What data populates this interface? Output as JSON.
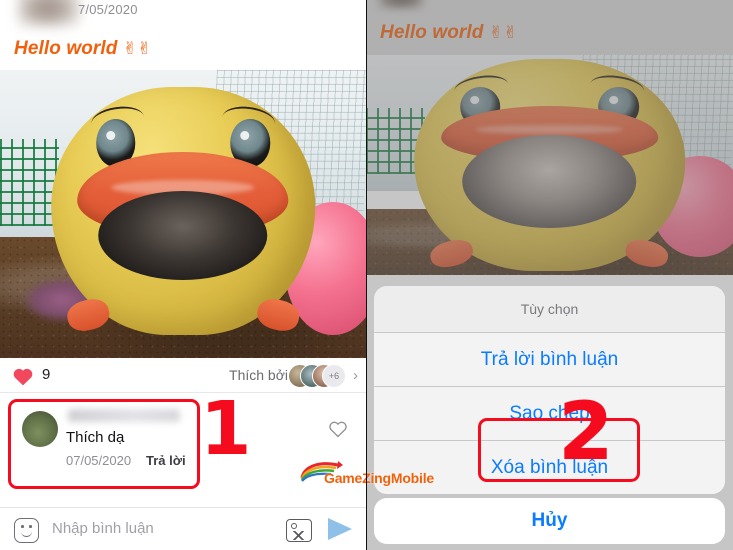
{
  "left": {
    "post_date": "7/05/2020",
    "caption": "Hello world",
    "caption_emoji": "✌✌",
    "likes": {
      "count": "9",
      "liked_by_label": "Thích bởi",
      "extra_count": "+6",
      "chevron": "›"
    },
    "comment": {
      "text": "Thích dạ",
      "date": "07/05/2020",
      "reply_label": "Trả lời"
    },
    "input": {
      "placeholder": "Nhập bình luận",
      "emoji_icon": "smiley-icon",
      "image_icon": "image-icon",
      "send_icon": "send-icon"
    },
    "annotation": "1"
  },
  "right": {
    "caption": "Hello world",
    "caption_emoji": "✌✌",
    "sheet": {
      "title": "Tùy chọn",
      "options": [
        "Trả lời bình luận",
        "Sao chép",
        "Xóa bình luận"
      ],
      "cancel": "Hủy"
    },
    "annotation": "2"
  },
  "watermark": {
    "text": "GameZingMobile"
  },
  "colors": {
    "accent_orange": "#f2600c",
    "annotation_red": "#f40c1e",
    "ios_blue": "#0a7cff",
    "heart_red": "#f2475c"
  }
}
